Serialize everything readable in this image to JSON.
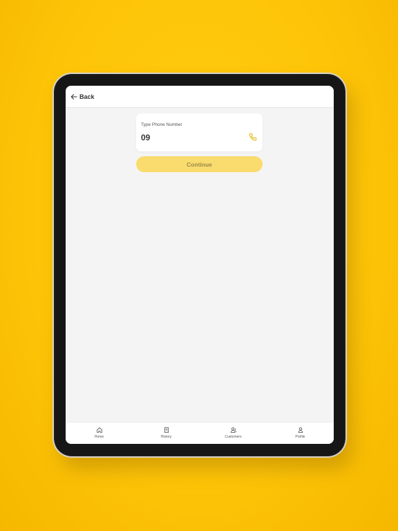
{
  "header": {
    "back_label": "Back"
  },
  "phone": {
    "label": "Type Phone Number",
    "value": "09"
  },
  "continue_label": "Continue",
  "nav": {
    "items": [
      {
        "label": "Home",
        "icon": "home-icon"
      },
      {
        "label": "History",
        "icon": "receipt-icon"
      },
      {
        "label": "Customers",
        "icon": "customers-icon"
      },
      {
        "label": "Profile",
        "icon": "profile-icon"
      }
    ]
  },
  "colors": {
    "background": "#FEC609",
    "accent": "#F2C300",
    "button_disabled": "#FADB6E"
  }
}
